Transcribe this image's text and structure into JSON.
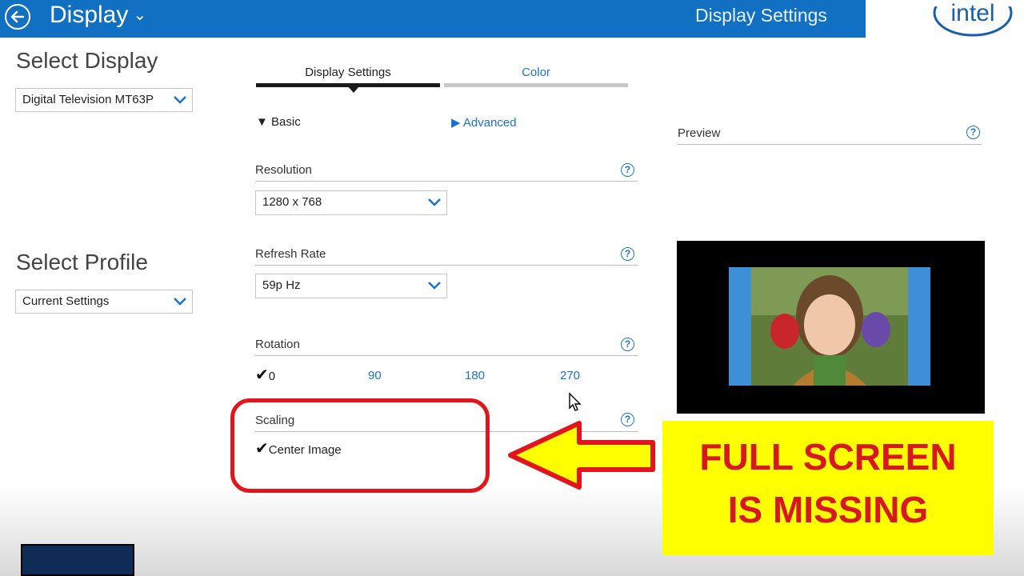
{
  "header": {
    "title": "Display",
    "section": "Display Settings"
  },
  "logo": {
    "text": "intel"
  },
  "left": {
    "select_display_title": "Select Display",
    "display_value": "Digital Television MT63P",
    "select_profile_title": "Select Profile",
    "profile_value": "Current Settings"
  },
  "tabs": [
    {
      "label": "Display Settings"
    },
    {
      "label": "Color"
    }
  ],
  "modes": {
    "basic": "Basic",
    "advanced": "Advanced"
  },
  "resolution": {
    "label": "Resolution",
    "value": "1280 x 768"
  },
  "refresh": {
    "label": "Refresh Rate",
    "value": "59p Hz"
  },
  "rotation": {
    "label": "Rotation",
    "options": [
      "0",
      "90",
      "180",
      "270"
    ]
  },
  "scaling": {
    "label": "Scaling",
    "value": "Center Image"
  },
  "preview": {
    "label": "Preview"
  },
  "help_glyph": "?",
  "callout": {
    "line1": "FULL SCREEN",
    "line2": "IS MISSING"
  },
  "colors": {
    "header": "#1270c2",
    "accent": "#1a73c9",
    "callout_red": "#e3141b",
    "callout_yellow": "#ffff00"
  }
}
